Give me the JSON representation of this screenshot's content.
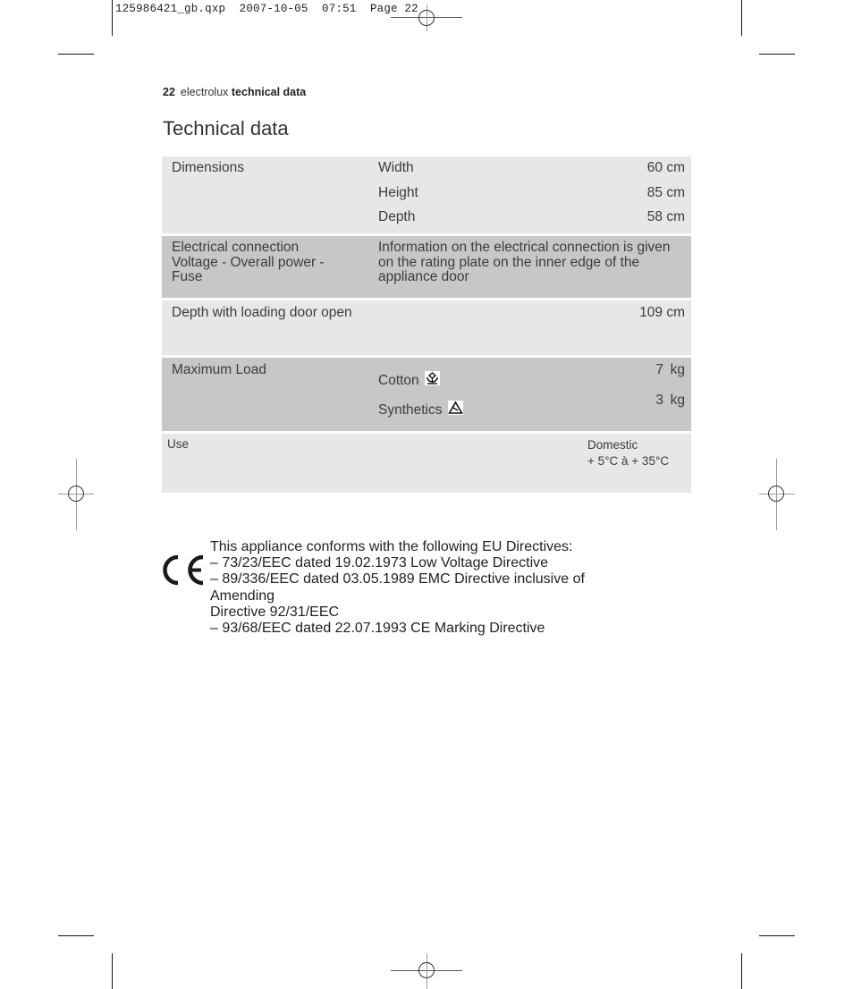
{
  "slug": {
    "text": "125986421_gb.qxp  2007-10-05  07:51  Page 22"
  },
  "running_header": {
    "page_number": "22",
    "brand": "electrolux",
    "section": "technical data"
  },
  "page_title": "Technical data",
  "table": {
    "dimensions": {
      "label": "Dimensions",
      "items": [
        {
          "name": "Width",
          "value": "60 cm"
        },
        {
          "name": "Height",
          "value": "85 cm"
        },
        {
          "name": "Depth",
          "value": "58 cm"
        }
      ]
    },
    "electrical": {
      "label_lines": [
        "Electrical connection",
        "Voltage - Overall power -",
        "Fuse"
      ],
      "info_lines": [
        "Information on the electrical connection is given",
        "on the rating plate on the inner edge of the",
        "appliance door"
      ]
    },
    "depth_door_open": {
      "label": "Depth with loading door open",
      "value": "109 cm"
    },
    "max_load": {
      "label": "Maximum Load",
      "items": [
        {
          "name": "Cotton",
          "icon": "cotton-symbol-icon",
          "amount": "7",
          "unit": "kg"
        },
        {
          "name": "Synthetics",
          "icon": "synthetics-symbol-icon",
          "amount": "3",
          "unit": "kg"
        }
      ]
    },
    "use": {
      "label": "Use",
      "value_lines": [
        "Domestic",
        "+ 5°C à + 35°C"
      ]
    }
  },
  "conformity": {
    "icon": "ce-mark-icon",
    "lines": [
      "This appliance conforms with the following EU Directives:",
      "– 73/23/EEC dated 19.02.1973 Low Voltage Directive",
      "– 89/336/EEC dated 03.05.1989 EMC Directive inclusive of",
      "Amending",
      "Directive 92/31/EEC",
      "– 93/68/EEC dated 22.07.1993 CE Marking Directive"
    ]
  }
}
